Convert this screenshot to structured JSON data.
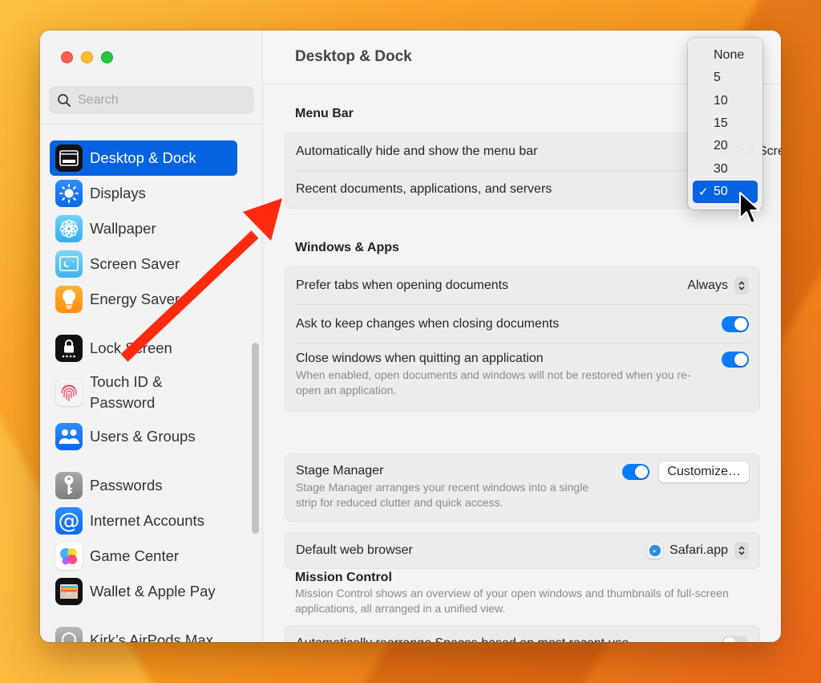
{
  "window": {
    "title": "Desktop & Dock"
  },
  "sidebar": {
    "search_placeholder": "Search",
    "items": [
      {
        "label": "Desktop & Dock",
        "icon": "desktop-dock-icon",
        "active": true
      },
      {
        "label": "Displays",
        "icon": "displays-icon"
      },
      {
        "label": "Wallpaper",
        "icon": "wallpaper-icon"
      },
      {
        "label": "Screen Saver",
        "icon": "screen-saver-icon"
      },
      {
        "label": "Energy Saver",
        "icon": "energy-saver-icon"
      },
      {
        "label": "Lock Screen",
        "icon": "lock-screen-icon"
      },
      {
        "label": "Touch ID & Password",
        "icon": "touch-id-icon"
      },
      {
        "label": "Users & Groups",
        "icon": "users-groups-icon"
      },
      {
        "label": "Passwords",
        "icon": "passwords-icon"
      },
      {
        "label": "Internet Accounts",
        "icon": "internet-accounts-icon"
      },
      {
        "label": "Game Center",
        "icon": "game-center-icon"
      },
      {
        "label": "Wallet & Apple Pay",
        "icon": "wallet-icon"
      },
      {
        "label": "Kirk’s AirPods Max",
        "icon": "airpods-max-icon"
      }
    ]
  },
  "main": {
    "title": "Desktop & Dock",
    "menu_bar": {
      "title": "Menu Bar",
      "rows": [
        {
          "label": "Automatically hide and show the menu bar",
          "value": "In Full Screen Only"
        },
        {
          "label": "Recent documents, applications, and servers",
          "value": "50"
        }
      ]
    },
    "windows_apps": {
      "title": "Windows & Apps",
      "rows": [
        {
          "label": "Prefer tabs when opening documents",
          "value": "Always"
        },
        {
          "label": "Ask to keep changes when closing documents",
          "toggle": true
        },
        {
          "label": "Close windows when quitting an application",
          "desc": "When enabled, open documents and windows will not be restored when you re-open an application.",
          "toggle": true
        }
      ]
    },
    "stage_manager": {
      "label": "Stage Manager",
      "desc": "Stage Manager arranges your recent windows into a single strip for reduced clutter and quick access.",
      "toggle": true,
      "button": "Customize…"
    },
    "browser": {
      "label": "Default web browser",
      "value": "Safari.app"
    },
    "mission_control": {
      "title": "Mission Control",
      "desc": "Mission Control shows an overview of your open windows and thumbnails of full-screen applications, all arranged in a unified view.",
      "rows": [
        {
          "label": "Automatically rearrange Spaces based on most recent use",
          "toggle": false
        }
      ]
    }
  },
  "dropdown": {
    "options": [
      "None",
      "5",
      "10",
      "15",
      "20",
      "30",
      "50"
    ],
    "selected": "50",
    "check": "✓"
  },
  "colors": {
    "accent": "#0563e1",
    "toggle_on": "#0a7cf8",
    "annotation_arrow": "#ff2a10"
  }
}
